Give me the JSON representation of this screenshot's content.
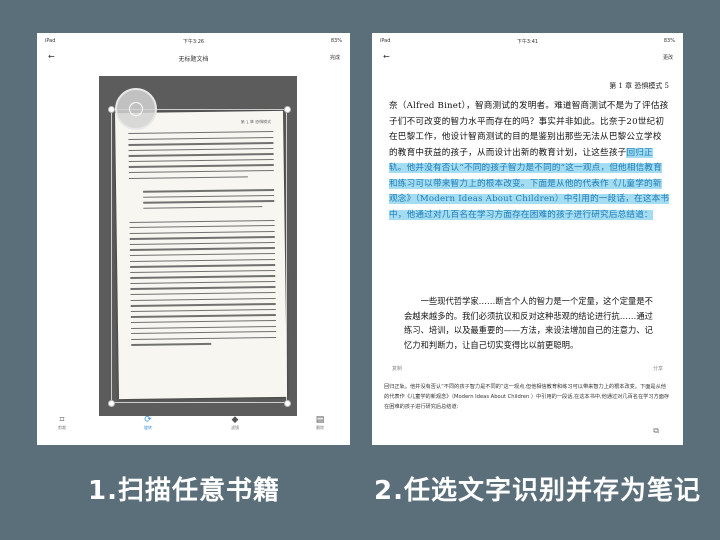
{
  "left": {
    "status": {
      "device": "iPad",
      "time": "下午3:26",
      "battery": "83%"
    },
    "nav": {
      "back": "←",
      "title": "无标题文档",
      "action": "完成"
    },
    "scan_header": "第 1 章  恐惧模式",
    "toolbar": [
      {
        "label": "剪裁",
        "icon": "crop-icon",
        "glyph": "⌗"
      },
      {
        "label": "旋转",
        "icon": "rotate-icon",
        "glyph": "⟳"
      },
      {
        "label": "滤镜",
        "icon": "filter-icon",
        "glyph": "◆"
      },
      {
        "label": "删除",
        "icon": "delete-icon",
        "glyph": "▤"
      }
    ]
  },
  "right": {
    "status": {
      "device": "iPad",
      "time": "下午3:41",
      "battery": "83%"
    },
    "nav": {
      "back": "←",
      "action": "更改"
    },
    "chapter_header": "第 1 章   恐惧模式   5",
    "body_plain": "奈（Alfred Binet），智商测试的发明者。难道智商测试不是为了评估孩子们不可改变的智力水平而存在的吗？事实并非如此。比奈于20世纪初在巴黎工作，他设计智商测试的目的是鉴别出那些无法从巴黎公立学校的教育中获益的孩子，从而设计出新的教育计划，让这些孩子",
    "body_highlight": "回归正轨。他并没有否认“不同的孩子智力是不同的”这一观点，但他相信教育和练习可以带来智力上的根本改变。下面是从他的代表作《儿童学的新观念》（Modern Ideas About Children）中引用的一段话，在这本书中，他通过对几百名在学习方面存在困难的孩子进行研究后总结道：",
    "quote": "一些现代哲学家……断言个人的智力是一个定量，这个定量是不会越来越多的。我们必须抗议和反对这种悲观的结论进行抗……通过练习、培训，以及最重要的——方法，来设法增加自己的注意力、记忆力和判断力，让自己切实变得比以前更聪明。",
    "popup_left": "复制",
    "popup_right": "分享",
    "note_text": "回归正轨。他并没有否认“不同的孩子智力是不同的”这一观点,但他相信教育和练习可以带来智力上的根本改变。下面是从他的代表作《儿童学的新观念》（Modern Ideas About Children ）中引用的一段话,在这本书中,他通过对几百名在学习方面存在困难的孩子进行研究后总结道:"
  },
  "captions": {
    "left": "1.扫描任意书籍",
    "right": "2.任选文字识别并存为笔记"
  },
  "colors": {
    "background": "#5b6f7b",
    "highlight_bg": "#a4ddf2",
    "highlight_text": "#1e7bb8",
    "accent": "#3b8fd9"
  }
}
